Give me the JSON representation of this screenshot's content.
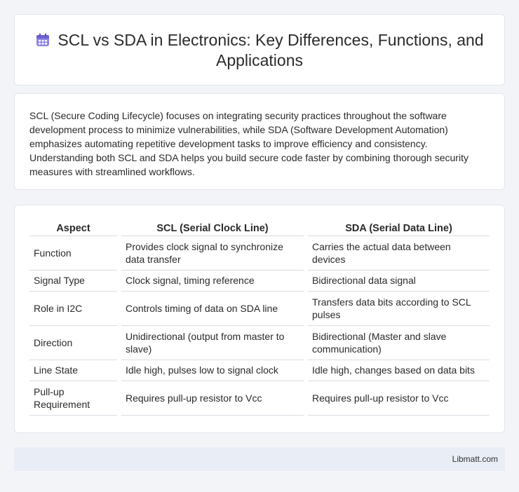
{
  "header": {
    "title": "SCL vs SDA in Electronics: Key Differences, Functions, and Applications",
    "icon": "calendar-icon",
    "icon_color": "#7b6fd6"
  },
  "intro": {
    "text": "SCL (Secure Coding Lifecycle) focuses on integrating security practices throughout the software development process to minimize vulnerabilities, while SDA (Software Development Automation) emphasizes automating repetitive development tasks to improve efficiency and consistency. Understanding both SCL and SDA helps you build secure code faster by combining thorough security measures with streamlined workflows."
  },
  "table": {
    "headers": [
      "Aspect",
      "SCL (Serial Clock Line)",
      "SDA (Serial Data Line)"
    ],
    "rows": [
      [
        "Function",
        "Provides clock signal to synchronize data transfer",
        "Carries the actual data between devices"
      ],
      [
        "Signal Type",
        "Clock signal, timing reference",
        "Bidirectional data signal"
      ],
      [
        "Role in I2C",
        "Controls timing of data on SDA line",
        "Transfers data bits according to SCL pulses"
      ],
      [
        "Direction",
        "Unidirectional (output from master to slave)",
        "Bidirectional (Master and slave communication)"
      ],
      [
        "Line State",
        "Idle high, pulses low to signal clock",
        "Idle high, changes based on data bits"
      ],
      [
        "Pull-up Requirement",
        "Requires pull-up resistor to Vcc",
        "Requires pull-up resistor to Vcc"
      ]
    ]
  },
  "footer": {
    "site": "Libmatt.com"
  }
}
